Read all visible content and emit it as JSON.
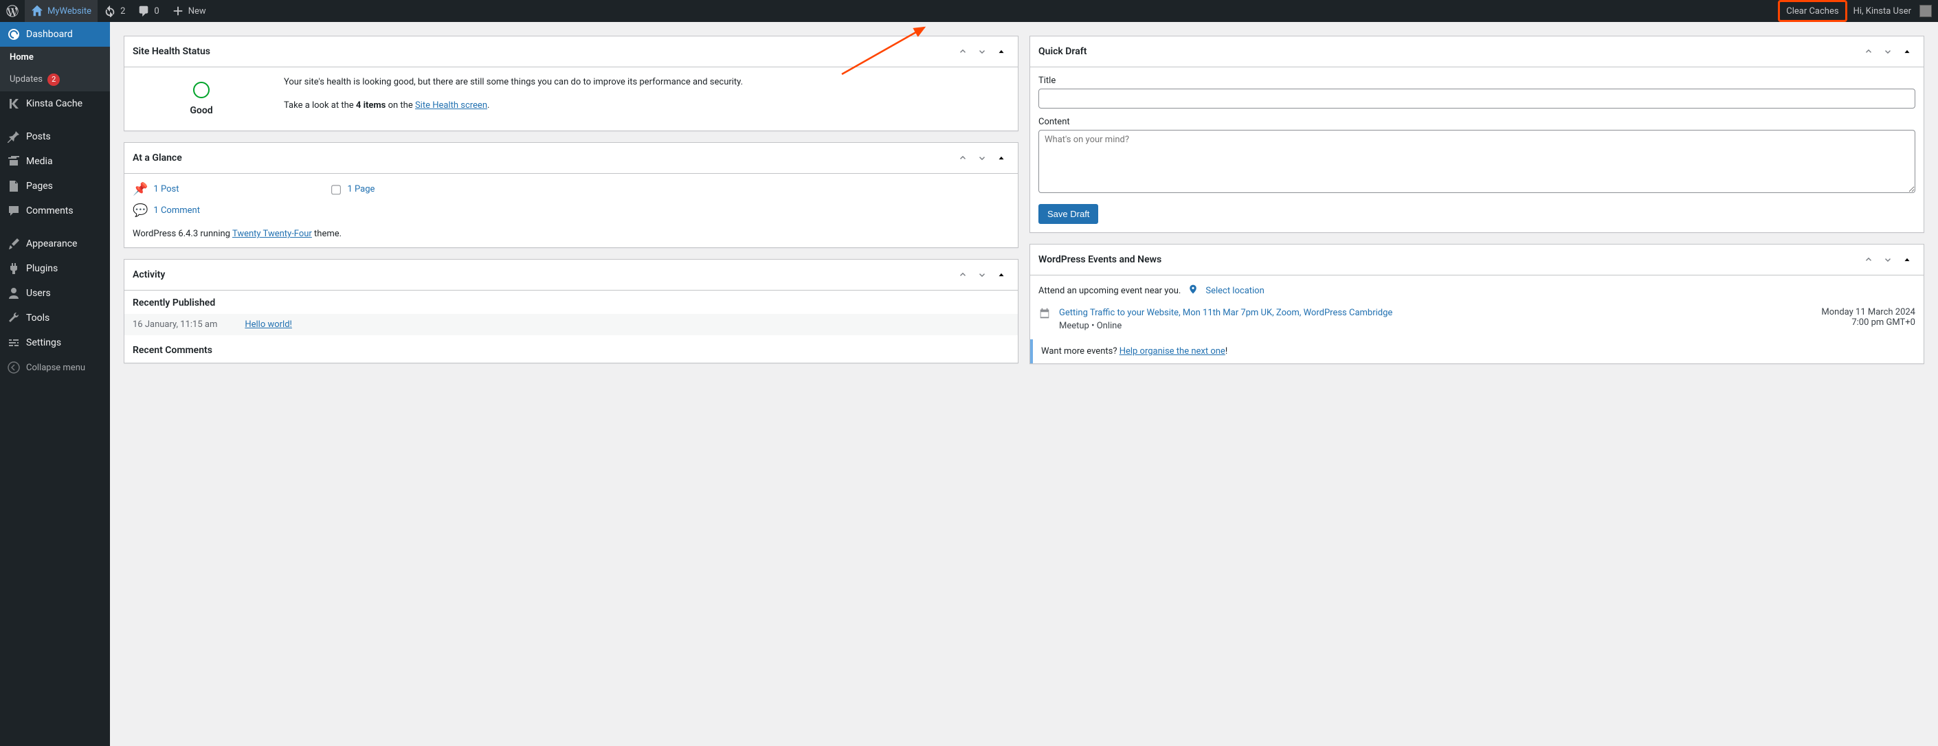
{
  "adminBar": {
    "siteName": "MyWebsite",
    "updateCount": "2",
    "commentCount": "0",
    "newLabel": "New",
    "clearCaches": "Clear Caches",
    "greeting": "Hi, Kinsta User"
  },
  "sidebar": {
    "dashboard": "Dashboard",
    "home": "Home",
    "updates": "Updates",
    "updatesBadge": "2",
    "kinstaCache": "Kinsta Cache",
    "posts": "Posts",
    "media": "Media",
    "pages": "Pages",
    "comments": "Comments",
    "appearance": "Appearance",
    "plugins": "Plugins",
    "users": "Users",
    "tools": "Tools",
    "settings": "Settings",
    "collapse": "Collapse menu"
  },
  "siteHealth": {
    "title": "Site Health Status",
    "gaugeLabel": "Good",
    "p1": "Your site's health is looking good, but there are still some things you can do to improve its performance and security.",
    "p2a": "Take a look at the ",
    "p2bold": "4 items",
    "p2b": " on the ",
    "p2link": "Site Health screen",
    "p2c": "."
  },
  "glance": {
    "title": "At a Glance",
    "posts": "1 Post",
    "pages": "1 Page",
    "comments": "1 Comment",
    "footerA": "WordPress 6.4.3 running ",
    "footerLink": "Twenty Twenty-Four",
    "footerB": " theme."
  },
  "activity": {
    "title": "Activity",
    "recently": "Recently Published",
    "date": "16 January, 11:15 am",
    "post": "Hello world!",
    "recentComments": "Recent Comments"
  },
  "quickDraft": {
    "title": "Quick Draft",
    "titleLabel": "Title",
    "contentLabel": "Content",
    "placeholder": "What's on your mind?",
    "save": "Save Draft"
  },
  "events": {
    "title": "WordPress Events and News",
    "attend": "Attend an upcoming event near you.",
    "selectLocation": "Select location",
    "eventTitle": "Getting Traffic to your Website, Mon 11th Mar 7pm UK, Zoom, WordPress Cambridge",
    "eventMeta": "Meetup • Online",
    "eventDate": "Monday 11 March 2024",
    "eventTime": "7:00 pm GMT+0",
    "wantMore": "Want more events? ",
    "helpOrganise": "Help organise the next one",
    "bang": "!"
  }
}
